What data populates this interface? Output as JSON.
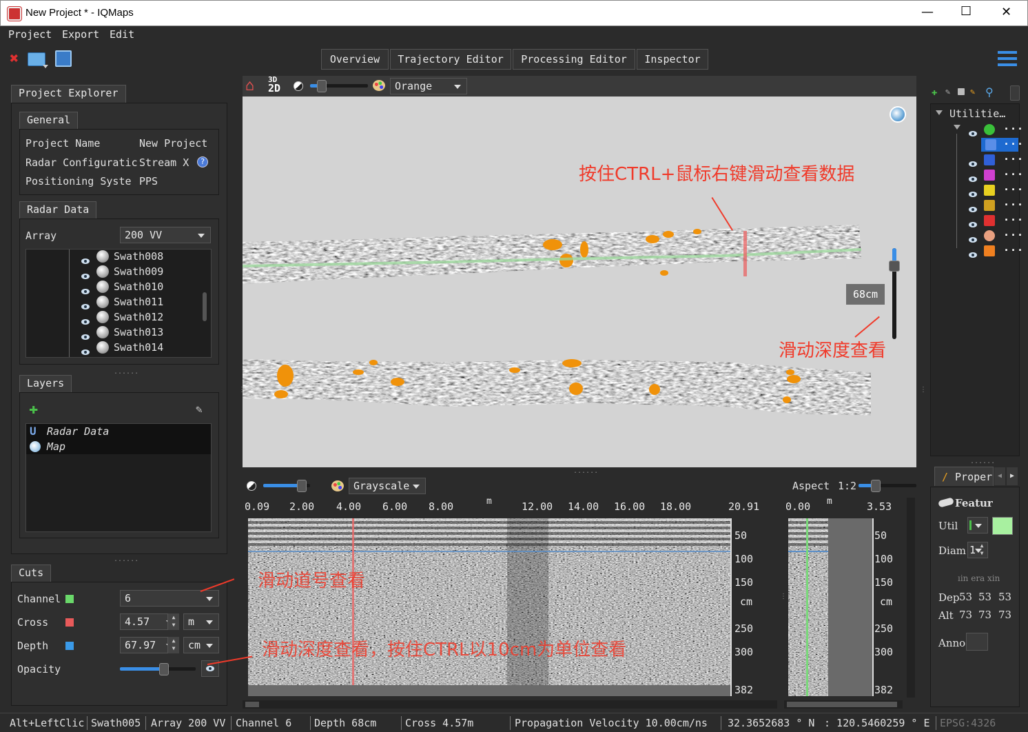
{
  "window": {
    "title": "New Project * - IQMaps",
    "minimize": "—",
    "maximize": "☐",
    "close": "✕"
  },
  "menu": [
    "Project",
    "Export",
    "Edit"
  ],
  "tabs": [
    "Overview",
    "Trajectory Editor",
    "Processing Editor",
    "Inspector"
  ],
  "project_explorer": {
    "title": "Project Explorer",
    "general_tab": "General",
    "fields": [
      {
        "label": "Project Name",
        "value": "New Project"
      },
      {
        "label": "Radar Configuratic",
        "value": "Stream X"
      },
      {
        "label": "Positioning Syste",
        "value": "PPS"
      }
    ],
    "radar_data_tab": "Radar Data",
    "array_label": "Array",
    "array_value": "200 VV",
    "swaths": [
      "Swath008",
      "Swath009",
      "Swath010",
      "Swath011",
      "Swath012",
      "Swath013",
      "Swath014"
    ]
  },
  "layers": {
    "title": "Layers",
    "items": [
      "Radar Data",
      "Map"
    ]
  },
  "cuts": {
    "title": "Cuts",
    "channel_label": "Channel",
    "channel_value": "6",
    "cross_label": "Cross",
    "cross_value": "4.57",
    "cross_unit": "m",
    "depth_label": "Depth",
    "depth_value": "67.97",
    "depth_unit": "cm",
    "opacity_label": "Opacity",
    "opacity_level": 0.8
  },
  "map_view": {
    "colormap": "Orange",
    "depth_badge": "68cm",
    "annotation_top": "按住CTRL+鼠标右键滑动查看数据",
    "annotation_right": "滑动深度查看",
    "colors": {
      "stripe_line": "#9ad89a",
      "cursor": "#e86a6a",
      "anomaly": "#f0920a"
    }
  },
  "section_view": {
    "colormap": "Grayscale",
    "aspect_label": "Aspect",
    "aspect_value": "1:2",
    "x_ticks": [
      "0.09",
      "2.00",
      "4.00",
      "6.00",
      "8.00",
      "12.00",
      "14.00",
      "16.00",
      "18.00",
      "20.91"
    ],
    "x_unit": "m",
    "y_ticks": [
      "50",
      "100",
      "150",
      "cm",
      "250",
      "300",
      "382"
    ],
    "small_x_ticks": [
      "0.00",
      "3.53"
    ],
    "small_x_unit": "m",
    "annotation_channel": "滑动道号查看",
    "annotation_depth": "滑动深度查看，按住CTRL以10cm为单位查看"
  },
  "utilities": {
    "title": "Utilitie…",
    "rows": [
      "help",
      "pipe",
      "flag",
      "camera",
      "house",
      "traffic",
      "hydrant",
      "manhole",
      "fuel"
    ]
  },
  "properties": {
    "title": "Proper",
    "feature_label": "Featur",
    "util_label": "Util",
    "diam_label": "Diam",
    "diam_value": "1",
    "header": "ıin era xin",
    "dep_label": "Dep",
    "dep_values": [
      "53",
      "53",
      "53"
    ],
    "alt_label": "Alt",
    "alt_values": [
      "73",
      "73",
      "73"
    ],
    "anno_label": "Anno"
  },
  "status": {
    "hint": "Alt+LeftClic",
    "swath": "Swath005",
    "array": "Array  200 VV",
    "channel": "Channel      6",
    "depth": "Depth      68cm",
    "cross": "Cross         4.57m",
    "velocity": "Propagation Velocity 10.00cm/ns",
    "lat": "32.3652683  ° N",
    "lon": ": 120.5460259  ° E",
    "epsg": "EPSG:4326"
  }
}
